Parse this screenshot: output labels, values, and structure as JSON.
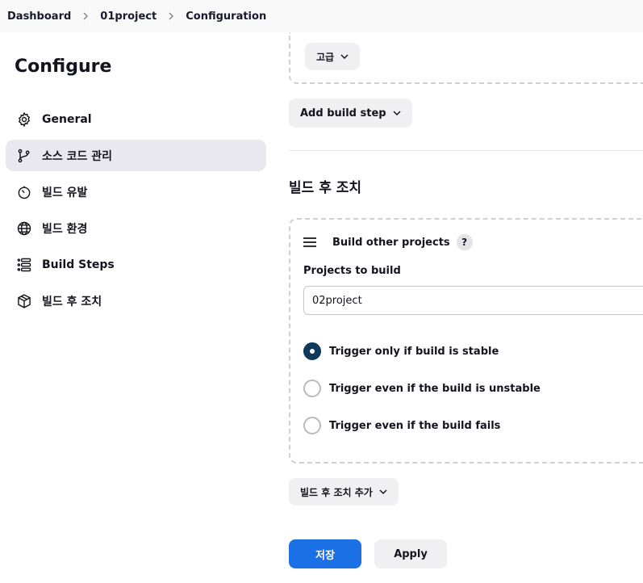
{
  "breadcrumb": {
    "items": [
      "Dashboard",
      "01project",
      "Configuration"
    ]
  },
  "sidebar": {
    "title": "Configure",
    "items": [
      {
        "label": "General",
        "icon": "gear-icon"
      },
      {
        "label": "소스 코드 관리",
        "icon": "branch-icon",
        "active": true
      },
      {
        "label": "빌드 유발",
        "icon": "timer-icon"
      },
      {
        "label": "빌드 환경",
        "icon": "globe-icon"
      },
      {
        "label": "Build Steps",
        "icon": "list-icon"
      },
      {
        "label": "빌드 후 조치",
        "icon": "package-icon"
      }
    ]
  },
  "main": {
    "advanced_label": "고급",
    "add_build_step_label": "Add build step",
    "post_build_title": "빌드 후 조치",
    "card": {
      "title": "Build other projects",
      "help": "?",
      "projects_label": "Projects to build",
      "projects_value": "02project",
      "options": [
        {
          "label": "Trigger only if build is stable",
          "checked": true
        },
        {
          "label": "Trigger even if the build is unstable",
          "checked": false
        },
        {
          "label": "Trigger even if the build fails",
          "checked": false
        }
      ]
    },
    "add_post_build_label": "빌드 후 조치 추가",
    "save_label": "저장",
    "apply_label": "Apply"
  },
  "colors": {
    "primary": "#1b70e6",
    "radio_checked": "#0f3a5c",
    "active_nav": "#e8e8ee"
  }
}
